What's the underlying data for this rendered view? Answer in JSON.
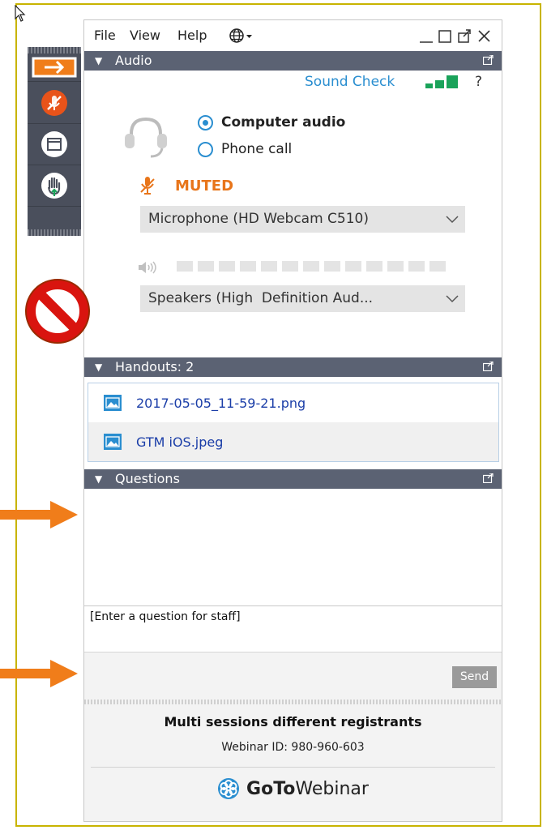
{
  "menu": {
    "file": "File",
    "view": "View",
    "help": "Help"
  },
  "audio": {
    "header": "Audio",
    "sound_check": "Sound Check",
    "help": "?",
    "computer_audio": "Computer audio",
    "phone_call": "Phone call",
    "selected": "computer_audio",
    "muted": "MUTED",
    "microphone": "Microphone (HD Webcam C510)",
    "speakers": "Speakers (High  Definition Aud...",
    "speaker_level_segments": 13
  },
  "handouts": {
    "header": "Handouts: 2",
    "files": [
      {
        "name": "2017-05-05_11-59-21.png"
      },
      {
        "name": "GTM iOS.jpeg"
      }
    ]
  },
  "questions": {
    "header": "Questions",
    "input_placeholder": "[Enter a question for staff]",
    "send": "Send"
  },
  "footer": {
    "session_title": "Multi sessions different registrants",
    "webinar_id": "Webinar ID: 980-960-603",
    "brand_bold": "GoTo",
    "brand_light": "Webinar"
  },
  "colors": {
    "header_bg": "#5b6273",
    "accent_blue": "#2a8ed0",
    "muted_orange": "#e8751a",
    "meter_green": "#1aa35a",
    "annotation_orange": "#f07d1a",
    "frame_yellow": "#c8b400"
  },
  "icons": {
    "toolbar": [
      "arrow-right-icon",
      "mute-microphone-icon",
      "window-icon",
      "raise-hand-icon"
    ],
    "annotations": [
      "no-sign-icon",
      "orange-arrow-icon"
    ]
  }
}
